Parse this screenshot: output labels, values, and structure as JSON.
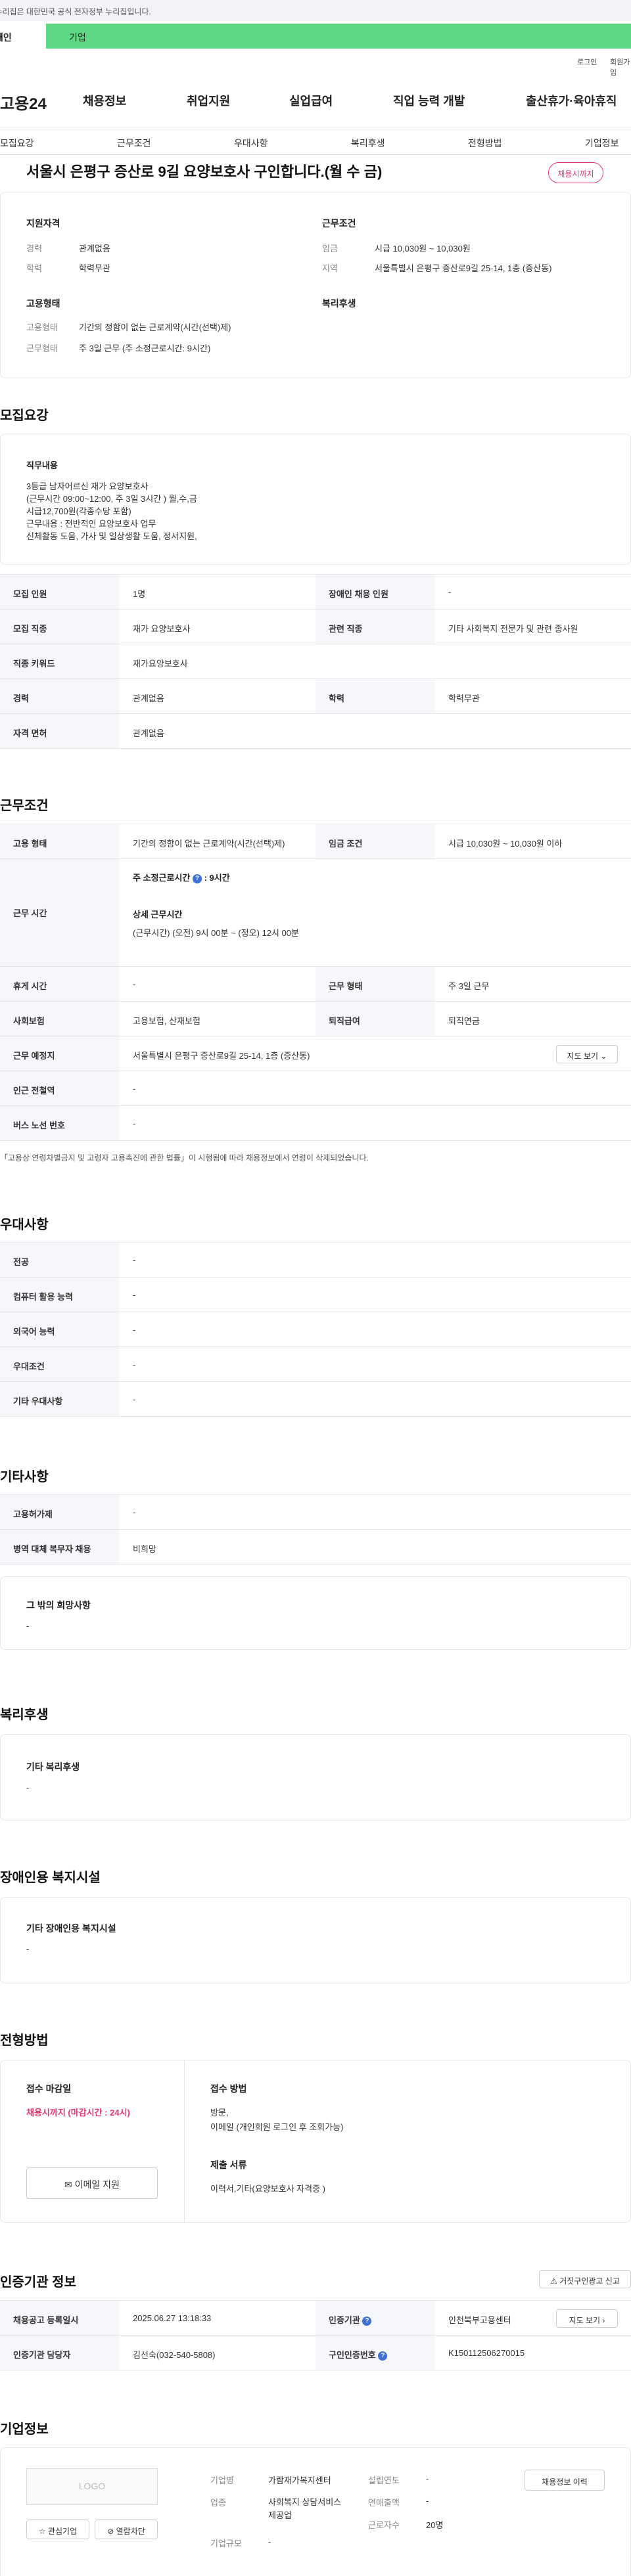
{
  "gov_notice": "이 누리집은 대한민국 공식 전자정부 누리집입니다.",
  "user_tabs": {
    "personal": "개인",
    "corporate": "기업"
  },
  "util_links": {
    "login": "로그인",
    "join": "회원가입"
  },
  "brand": "고용24",
  "gnb": [
    "채용정보",
    "취업지원",
    "실업급여",
    "직업 능력 개발",
    "출산휴가·육아휴직"
  ],
  "lnb": [
    "모집요강",
    "근무조건",
    "우대사항",
    "복리후생",
    "전형방법",
    "기업정보"
  ],
  "job_title": "서울시 은평구 증산로 9길 요양보호사 구인합니다.(월 수 금)",
  "deadline_badge": "채용시까지",
  "summary": {
    "qualification": {
      "heading": "지원자격",
      "rows": [
        {
          "label": "경력",
          "value": "관계없음"
        },
        {
          "label": "학력",
          "value": "학력무관"
        }
      ]
    },
    "employment": {
      "heading": "고용형태",
      "rows": [
        {
          "label": "고용형태",
          "value": "기간의 정함이 없는 근로계약(시간(선택)제)"
        },
        {
          "label": "근무형태",
          "value": "주 3일 근무 (주 소정근로시간: 9시간)"
        }
      ]
    },
    "conditions": {
      "heading": "근무조건",
      "rows": [
        {
          "label": "임금",
          "value": "시급 10,030원 ~ 10,030원"
        },
        {
          "label": "지역",
          "value": "서울특별시 은평구 증산로9길 25-14, 1층 (증산동)"
        }
      ]
    },
    "welfare": {
      "heading": "복리후생"
    }
  },
  "recruit": {
    "heading": "모집요강",
    "duty_heading": "직무내용",
    "duty_lines": [
      "3등급  남자어르신 재가 요양보호사",
      "(근무시간 09:00~12:00, 주 3일 3시간 ) 월,수,금",
      "시급12,700원(각종수당 포함)",
      "근무내용 : 전반적인 요양보호사 업무",
      "신체활동 도움, 가사 및 일상생활 도움, 정서지원,"
    ],
    "rows": [
      [
        {
          "th": "모집 인원",
          "td": "1명"
        },
        {
          "th": "장애인 채용 인원",
          "td": "-"
        }
      ],
      [
        {
          "th": "모집 직종",
          "td": "재가 요양보호사"
        },
        {
          "th": "관련 직종",
          "td": "기타 사회복지 전문가 및 관련 종사원"
        }
      ],
      [
        {
          "th": "직종 키워드",
          "td": "재가요양보호사"
        }
      ],
      [
        {
          "th": "경력",
          "td": "관계없음"
        },
        {
          "th": "학력",
          "td": "학력무관"
        }
      ],
      [
        {
          "th": "자격 면허",
          "td": "관계없음"
        }
      ]
    ]
  },
  "work": {
    "heading": "근무조건",
    "employment_type": {
      "th": "고용 형태",
      "td": "기간의 정함이 없는 근로계약(시간(선택)제)"
    },
    "wage": {
      "th": "임금 조건",
      "td": "시급 10,030원 ~ 10,030원 이하"
    },
    "hours_th": "근무 시간",
    "weekly_hours": "주 소정근로시간",
    "weekly_hours_value": ": 9시간",
    "detail_heading": "상세 근무시간",
    "detail_value": "(근무시간) (오전) 9시 00분 ~ (정오) 12시 00분",
    "rows": [
      [
        {
          "th": "휴게 시간",
          "td": "-"
        },
        {
          "th": "근무 형태",
          "td": "주 3일 근무"
        }
      ],
      [
        {
          "th": "사회보험",
          "td": "고용보험, 산재보험"
        },
        {
          "th": "퇴직급여",
          "td": "퇴직연금"
        }
      ]
    ],
    "location": {
      "th": "근무 예정지",
      "td": "서울특별시 은평구 증산로9길 25-14, 1층 (증산동)"
    },
    "map_button": "지도 보기",
    "subway": {
      "th": "인근 전철역",
      "td": "-"
    },
    "bus": {
      "th": "버스 노선 번호",
      "td": "-"
    },
    "note": "「고용상 연령차별금지 및 고령자 고용촉진에 관한 법률」이 시행됨에 따라 채용정보에서 연령이 삭제되었습니다."
  },
  "preference": {
    "heading": "우대사항",
    "rows": [
      {
        "th": "전공",
        "td": "-"
      },
      {
        "th": "컴퓨터 활용 능력",
        "td": "-"
      },
      {
        "th": "외국어 능력",
        "td": "-"
      },
      {
        "th": "우대조건",
        "td": "-"
      },
      {
        "th": "기타 우대사항",
        "td": "-"
      }
    ]
  },
  "other": {
    "heading": "기타사항",
    "rows": [
      {
        "th": "고용허가제",
        "td": "-"
      },
      {
        "th": "병역 대체 복무자 채용",
        "td": "비희망"
      }
    ],
    "wish_heading": "그 밖의 희망사항",
    "wish_value": "-"
  },
  "welfare": {
    "heading": "복리후생",
    "box_heading": "기타 복리후생",
    "box_value": "-"
  },
  "disability": {
    "heading": "장애인용 복지시설",
    "box_heading": "기타 장애인용 복지시설",
    "box_value": "-"
  },
  "selection": {
    "heading": "전형방법",
    "deadline_heading": "접수 마감일",
    "deadline_value": "채용시까지 (마감시간 : 24시)",
    "email_button": "이메일 지원",
    "method_heading": "접수 방법",
    "method_lines": [
      "방문,",
      "이메일 (개인회원 로그인 후 조회가능)"
    ],
    "docs_heading": "제출 서류",
    "docs_value": "이력서,기타(요양보호사 자격증 )"
  },
  "certification": {
    "heading": "인증기관 정보",
    "report_button": "거짓구인광고 신고",
    "rows": [
      [
        {
          "th": "채용공고 등록일시",
          "td": "2025.06.27 13:18:33"
        },
        {
          "th": "인증기관",
          "td": "인천북부고용센터"
        }
      ],
      [
        {
          "th": "인증기관 담당자",
          "td": "김선숙(032-540-5808)"
        },
        {
          "th": "구인인증번호",
          "td": "K150112506270015"
        }
      ]
    ],
    "map_button": "지도 보기"
  },
  "company": {
    "heading": "기업정보",
    "logo_text": "LOGO",
    "fav_button": "관심기업",
    "block_button": "열람차단",
    "history_button": "채용정보 이력",
    "rows": [
      {
        "th": "기업명",
        "td": "가람재가복지센터"
      },
      {
        "th": "업종",
        "td": "사회복지 상담서비스 제공업"
      },
      {
        "th": "기업규모",
        "td": "-"
      }
    ],
    "rows_right": [
      {
        "th": "설립연도",
        "td": "-"
      },
      {
        "th": "연매출액",
        "td": "-"
      },
      {
        "th": "근로자수",
        "td": "20명"
      }
    ]
  }
}
